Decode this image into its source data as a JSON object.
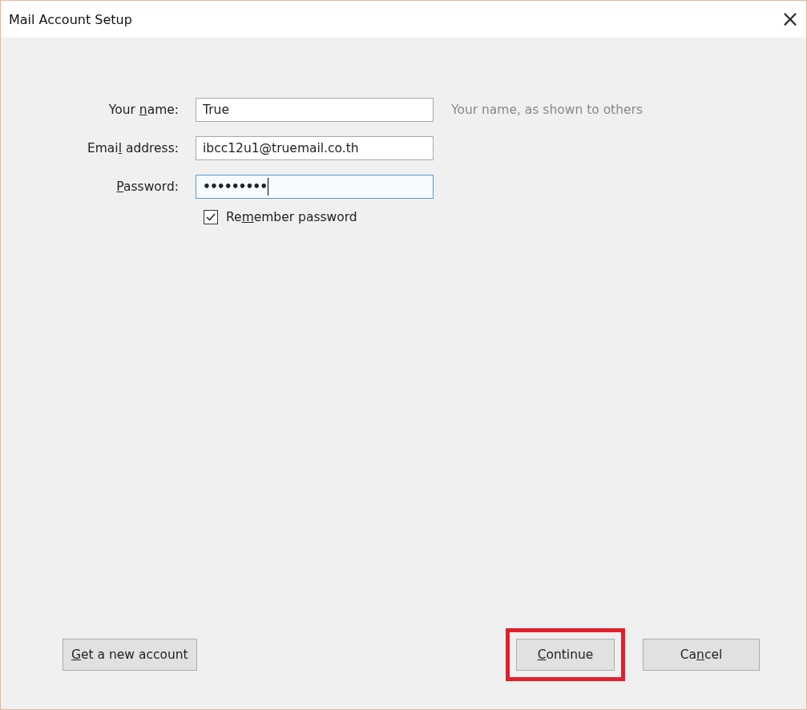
{
  "window": {
    "title": "Mail Account Setup",
    "close": "×"
  },
  "fields": [
    {
      "label": {
        "before": "Your ",
        "key": "n",
        "after": "ame:"
      },
      "value": "True",
      "kind": "text",
      "focused": false,
      "hint": "Your name, as shown to others"
    },
    {
      "label": {
        "before": "Emai",
        "key": "l",
        "after": " address:"
      },
      "value": "ibcc12u1@truemail.co.th",
      "kind": "text",
      "focused": false
    },
    {
      "label": {
        "key": "P",
        "after": "assword:"
      },
      "value": "•••••••••",
      "kind": "password",
      "focused": true
    }
  ],
  "remember": {
    "label": {
      "before": "Re",
      "key": "m",
      "after": "ember password"
    },
    "checked": true
  },
  "buttons": [
    {
      "label": {
        "key": "G",
        "after": "et a new account"
      },
      "highlighted": false,
      "kind": "left"
    },
    {
      "label": {
        "key": "C",
        "after": "ontinue"
      },
      "highlighted": true,
      "kind": "right"
    },
    {
      "label": {
        "before": "Ca",
        "key": "n",
        "after": "cel"
      },
      "highlighted": false,
      "kind": "right"
    }
  ]
}
